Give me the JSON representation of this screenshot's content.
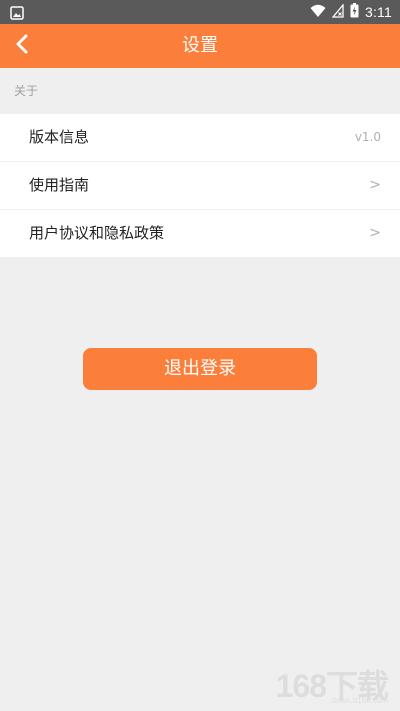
{
  "status_bar": {
    "time": "3:11"
  },
  "header": {
    "title": "设置",
    "back_icon": "chevron-left-icon"
  },
  "section": {
    "label": "关于"
  },
  "list": {
    "items": [
      {
        "label": "版本信息",
        "value": "v1.0"
      },
      {
        "label": "使用指南",
        "arrow": ">"
      },
      {
        "label": "用户协议和隐私政策",
        "arrow": ">"
      }
    ]
  },
  "actions": {
    "logout_label": "退出登录"
  },
  "watermark": {
    "text": "168下载",
    "url": "down.tt168.com"
  },
  "colors": {
    "accent": "#fb7f3a",
    "status_bar": "#5a5a5a",
    "background": "#efefef"
  }
}
